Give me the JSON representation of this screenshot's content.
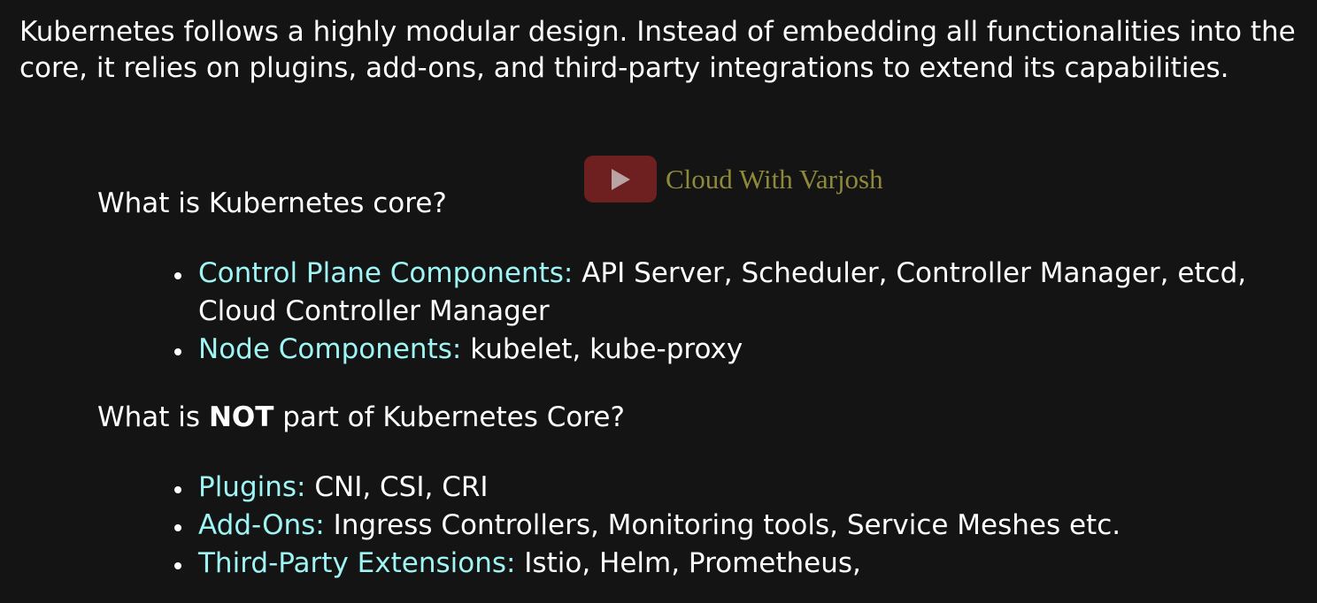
{
  "intro": "Kubernetes follows a highly modular design. Instead of embedding all functionalities into the core, it relies on plugins, add-ons, and third-party integrations to extend its capabilities.",
  "watermark": {
    "icon": "play-icon",
    "text": "Cloud With Varjosh",
    "button_color": "#6e1f1f",
    "text_color": "#8f8a3a"
  },
  "core": {
    "heading": "What is Kubernetes core?",
    "items": [
      {
        "key": "Control Plane Components:",
        "text": " API Server, Scheduler, Controller Manager, etcd, Cloud Controller Manager"
      },
      {
        "key": "Node Components:",
        "text": " kubelet, kube-proxy"
      }
    ]
  },
  "not_core": {
    "heading_pre": "What is ",
    "heading_bold": "NOT",
    "heading_post": " part of Kubernetes Core?",
    "items": [
      {
        "key": "Plugins:",
        "text": " CNI, CSI, CRI"
      },
      {
        "key": "Add-Ons:",
        "text": " Ingress Controllers, Monitoring tools, Service Meshes etc."
      },
      {
        "key": "Third-Party Extensions:",
        "text": " Istio, Helm, Prometheus,"
      }
    ]
  },
  "colors": {
    "background": "#141414",
    "text": "#ffffff",
    "accent": "#9ff4f4"
  }
}
